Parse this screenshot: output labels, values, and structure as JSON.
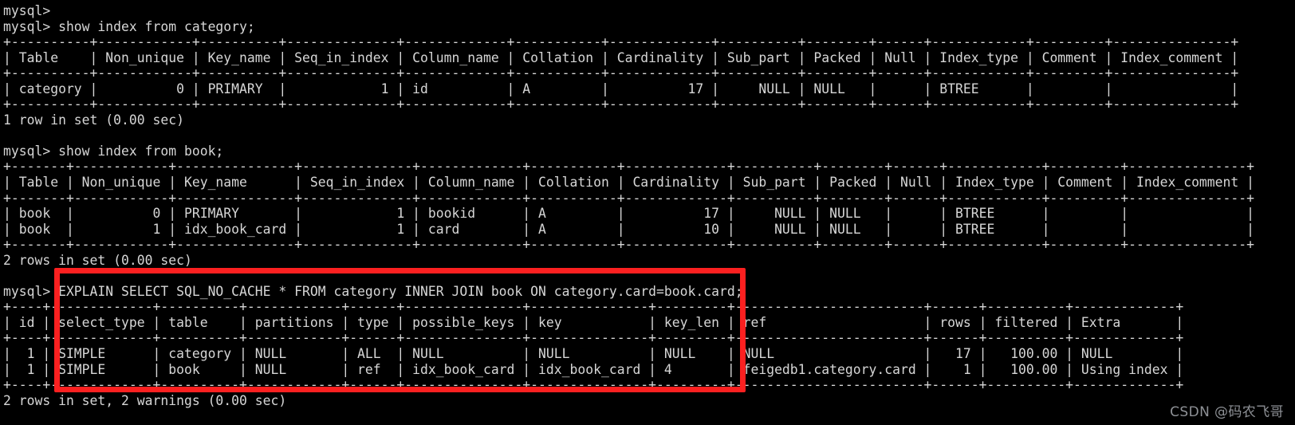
{
  "terminal": {
    "prompt": "mysql>",
    "theme": {
      "background": "#000000",
      "foreground": "#d6d6d6",
      "highlight": "#fb2020",
      "watermark_color": "#8e9196"
    },
    "lines": [
      "mysql>",
      "mysql> show index from category;",
      "+----------+------------+----------+--------------+-------------+-----------+-------------+----------+--------+------+------------+---------+---------------+",
      "| Table    | Non_unique | Key_name | Seq_in_index | Column_name | Collation | Cardinality | Sub_part | Packed | Null | Index_type | Comment | Index_comment |",
      "+----------+------------+----------+--------------+-------------+-----------+-------------+----------+--------+------+------------+---------+---------------+",
      "| category |          0 | PRIMARY  |            1 | id          | A         |          17 |     NULL | NULL   |      | BTREE      |         |               |",
      "+----------+------------+----------+--------------+-------------+-----------+-------------+----------+--------+------+------------+---------+---------------+",
      "1 row in set (0.00 sec)",
      "",
      "mysql> show index from book;",
      "+-------+------------+---------------+--------------+-------------+-----------+-------------+----------+--------+------+------------+---------+---------------+",
      "| Table | Non_unique | Key_name      | Seq_in_index | Column_name | Collation | Cardinality | Sub_part | Packed | Null | Index_type | Comment | Index_comment |",
      "+-------+------------+---------------+--------------+-------------+-----------+-------------+----------+--------+------+------------+---------+---------------+",
      "| book  |          0 | PRIMARY       |            1 | bookid      | A         |          17 |     NULL | NULL   |      | BTREE      |         |               |",
      "| book  |          1 | idx_book_card |            1 | card        | A         |          10 |     NULL | NULL   |      | BTREE      |         |               |",
      "+-------+------------+---------------+--------------+-------------+-----------+-------------+----------+--------+------+------------+---------+---------------+",
      "2 rows in set (0.00 sec)",
      "",
      "mysql> EXPLAIN SELECT SQL_NO_CACHE * FROM category INNER JOIN book ON category.card=book.card;",
      "+----+-------------+----------+------------+------+---------------+---------------+---------+------------------------+------+----------+-------------+",
      "|&nbsp;id | select_type | table    | partitions | type | possible_keys | key           | key_len | ref                    | rows | filtered | Extra       |",
      "+----+-------------+----------+------------+------+---------------+---------------+---------+------------------------+------+----------+-------------+",
      "|  1 | SIMPLE      | category | NULL       | ALL  | NULL          | NULL          | NULL    | NULL                   |   17 |   100.00 | NULL        |",
      "|  1 | SIMPLE      | book     | NULL       | ref  | idx_book_card | idx_book_card | 4       | feigedb1.category.card |    1 |   100.00 | Using index |",
      "+----+-------------+----------+------------+------+---------------+---------------+---------+------------------------+------+----------+-------------+",
      "2 rows in set, 2 warnings (0.00 sec)"
    ],
    "commands": [
      "show index from category;",
      "show index from book;",
      "EXPLAIN SELECT SQL_NO_CACHE * FROM category INNER JOIN book ON category.card=book.card;"
    ],
    "results": [
      {
        "name": "show-index-category",
        "columns": [
          "Table",
          "Non_unique",
          "Key_name",
          "Seq_in_index",
          "Column_name",
          "Collation",
          "Cardinality",
          "Sub_part",
          "Packed",
          "Null",
          "Index_type",
          "Comment",
          "Index_comment"
        ],
        "rows": [
          [
            "category",
            "0",
            "PRIMARY",
            "1",
            "id",
            "A",
            "17",
            "NULL",
            "NULL",
            "",
            "BTREE",
            "",
            ""
          ]
        ],
        "status": "1 row in set (0.00 sec)"
      },
      {
        "name": "show-index-book",
        "columns": [
          "Table",
          "Non_unique",
          "Key_name",
          "Seq_in_index",
          "Column_name",
          "Collation",
          "Cardinality",
          "Sub_part",
          "Packed",
          "Null",
          "Index_type",
          "Comment",
          "Index_comment"
        ],
        "rows": [
          [
            "book",
            "0",
            "PRIMARY",
            "1",
            "bookid",
            "A",
            "17",
            "NULL",
            "NULL",
            "",
            "BTREE",
            "",
            ""
          ],
          [
            "book",
            "1",
            "idx_book_card",
            "1",
            "card",
            "A",
            "10",
            "NULL",
            "NULL",
            "",
            "BTREE",
            "",
            ""
          ]
        ],
        "status": "2 rows in set (0.00 sec)"
      },
      {
        "name": "explain-join",
        "columns": [
          "id",
          "select_type",
          "table",
          "partitions",
          "type",
          "possible_keys",
          "key",
          "key_len",
          "ref",
          "rows",
          "filtered",
          "Extra"
        ],
        "rows": [
          [
            "1",
            "SIMPLE",
            "category",
            "NULL",
            "ALL",
            "NULL",
            "NULL",
            "NULL",
            "NULL",
            "17",
            "100.00",
            "NULL"
          ],
          [
            "1",
            "SIMPLE",
            "book",
            "NULL",
            "ref",
            "idx_book_card",
            "idx_book_card",
            "4",
            "feigedb1.category.card",
            "1",
            "100.00",
            "Using index"
          ]
        ],
        "status": "2 rows in set, 2 warnings (0.00 sec)"
      }
    ]
  },
  "annotation": {
    "label": "explain-highlight",
    "color": "#fb2020"
  },
  "watermark": {
    "text": "CSDN @码农飞哥"
  }
}
